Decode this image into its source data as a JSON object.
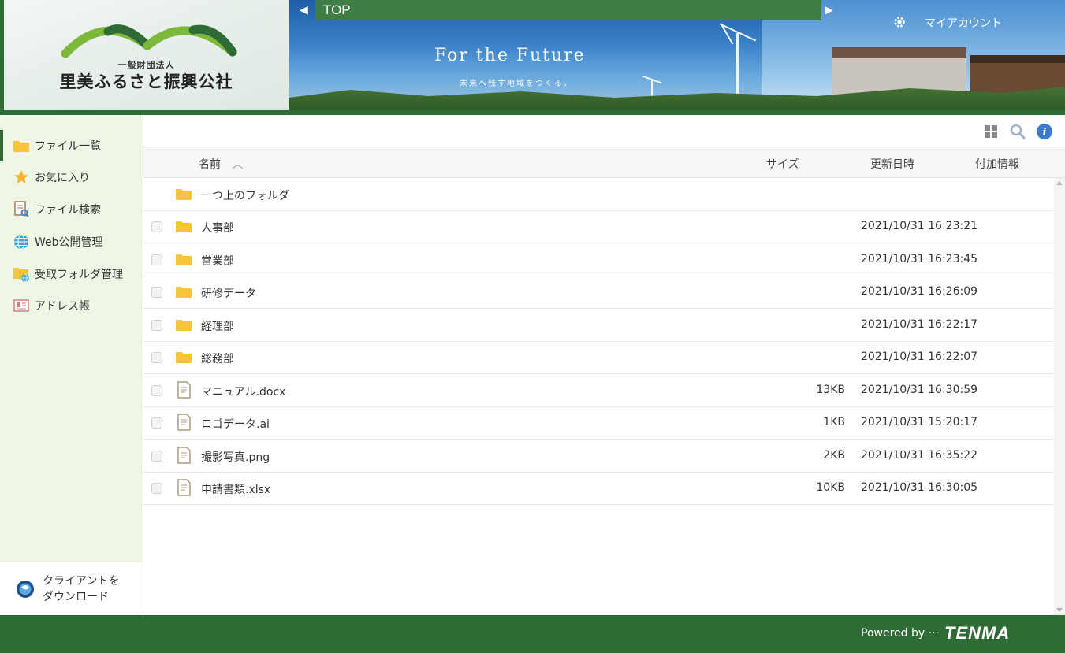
{
  "header": {
    "org_sub": "一般財団法人",
    "org_name": "里美ふるさと振興公社",
    "banner_title": "For the Future",
    "banner_sub": "未来へ残す地域をつくる。",
    "breadcrumb": "TOP",
    "account_label": "マイアカウント"
  },
  "sidebar": {
    "items": [
      {
        "label": "ファイル一覧",
        "icon": "folder-icon"
      },
      {
        "label": "お気に入り",
        "icon": "star-icon"
      },
      {
        "label": "ファイル検索",
        "icon": "file-search-icon"
      },
      {
        "label": "Web公開管理",
        "icon": "globe-icon"
      },
      {
        "label": "受取フォルダ管理",
        "icon": "folder-globe-icon"
      },
      {
        "label": "アドレス帳",
        "icon": "address-card-icon"
      }
    ],
    "client_download_line1": "クライアントを",
    "client_download_line2": "ダウンロード"
  },
  "table": {
    "col_name": "名前",
    "col_size": "サイズ",
    "col_date": "更新日時",
    "col_extra": "付加情報",
    "parent_folder": "一つ上のフォルダ",
    "rows": [
      {
        "name": "人事部",
        "type": "folder",
        "size": "",
        "date": "2021/10/31 16:23:21"
      },
      {
        "name": "営業部",
        "type": "folder",
        "size": "",
        "date": "2021/10/31 16:23:45"
      },
      {
        "name": "研修データ",
        "type": "folder",
        "size": "",
        "date": "2021/10/31 16:26:09"
      },
      {
        "name": "経理部",
        "type": "folder",
        "size": "",
        "date": "2021/10/31 16:22:17"
      },
      {
        "name": "総務部",
        "type": "folder",
        "size": "",
        "date": "2021/10/31 16:22:07"
      },
      {
        "name": "マニュアル.docx",
        "type": "file",
        "size": "13KB",
        "date": "2021/10/31 16:30:59"
      },
      {
        "name": "ロゴデータ.ai",
        "type": "file",
        "size": "1KB",
        "date": "2021/10/31 15:20:17"
      },
      {
        "name": "撮影写真.png",
        "type": "file",
        "size": "2KB",
        "date": "2021/10/31 16:35:22"
      },
      {
        "name": "申請書類.xlsx",
        "type": "file",
        "size": "10KB",
        "date": "2021/10/31 16:30:05"
      }
    ]
  },
  "footer": {
    "powered": "Powered by ···",
    "brand": "TENMA"
  },
  "colors": {
    "brand_green": "#2e6b35",
    "sidebar_bg": "#eef6e6",
    "folder_yellow": "#f7c33a",
    "info_blue": "#3b7bd0"
  }
}
